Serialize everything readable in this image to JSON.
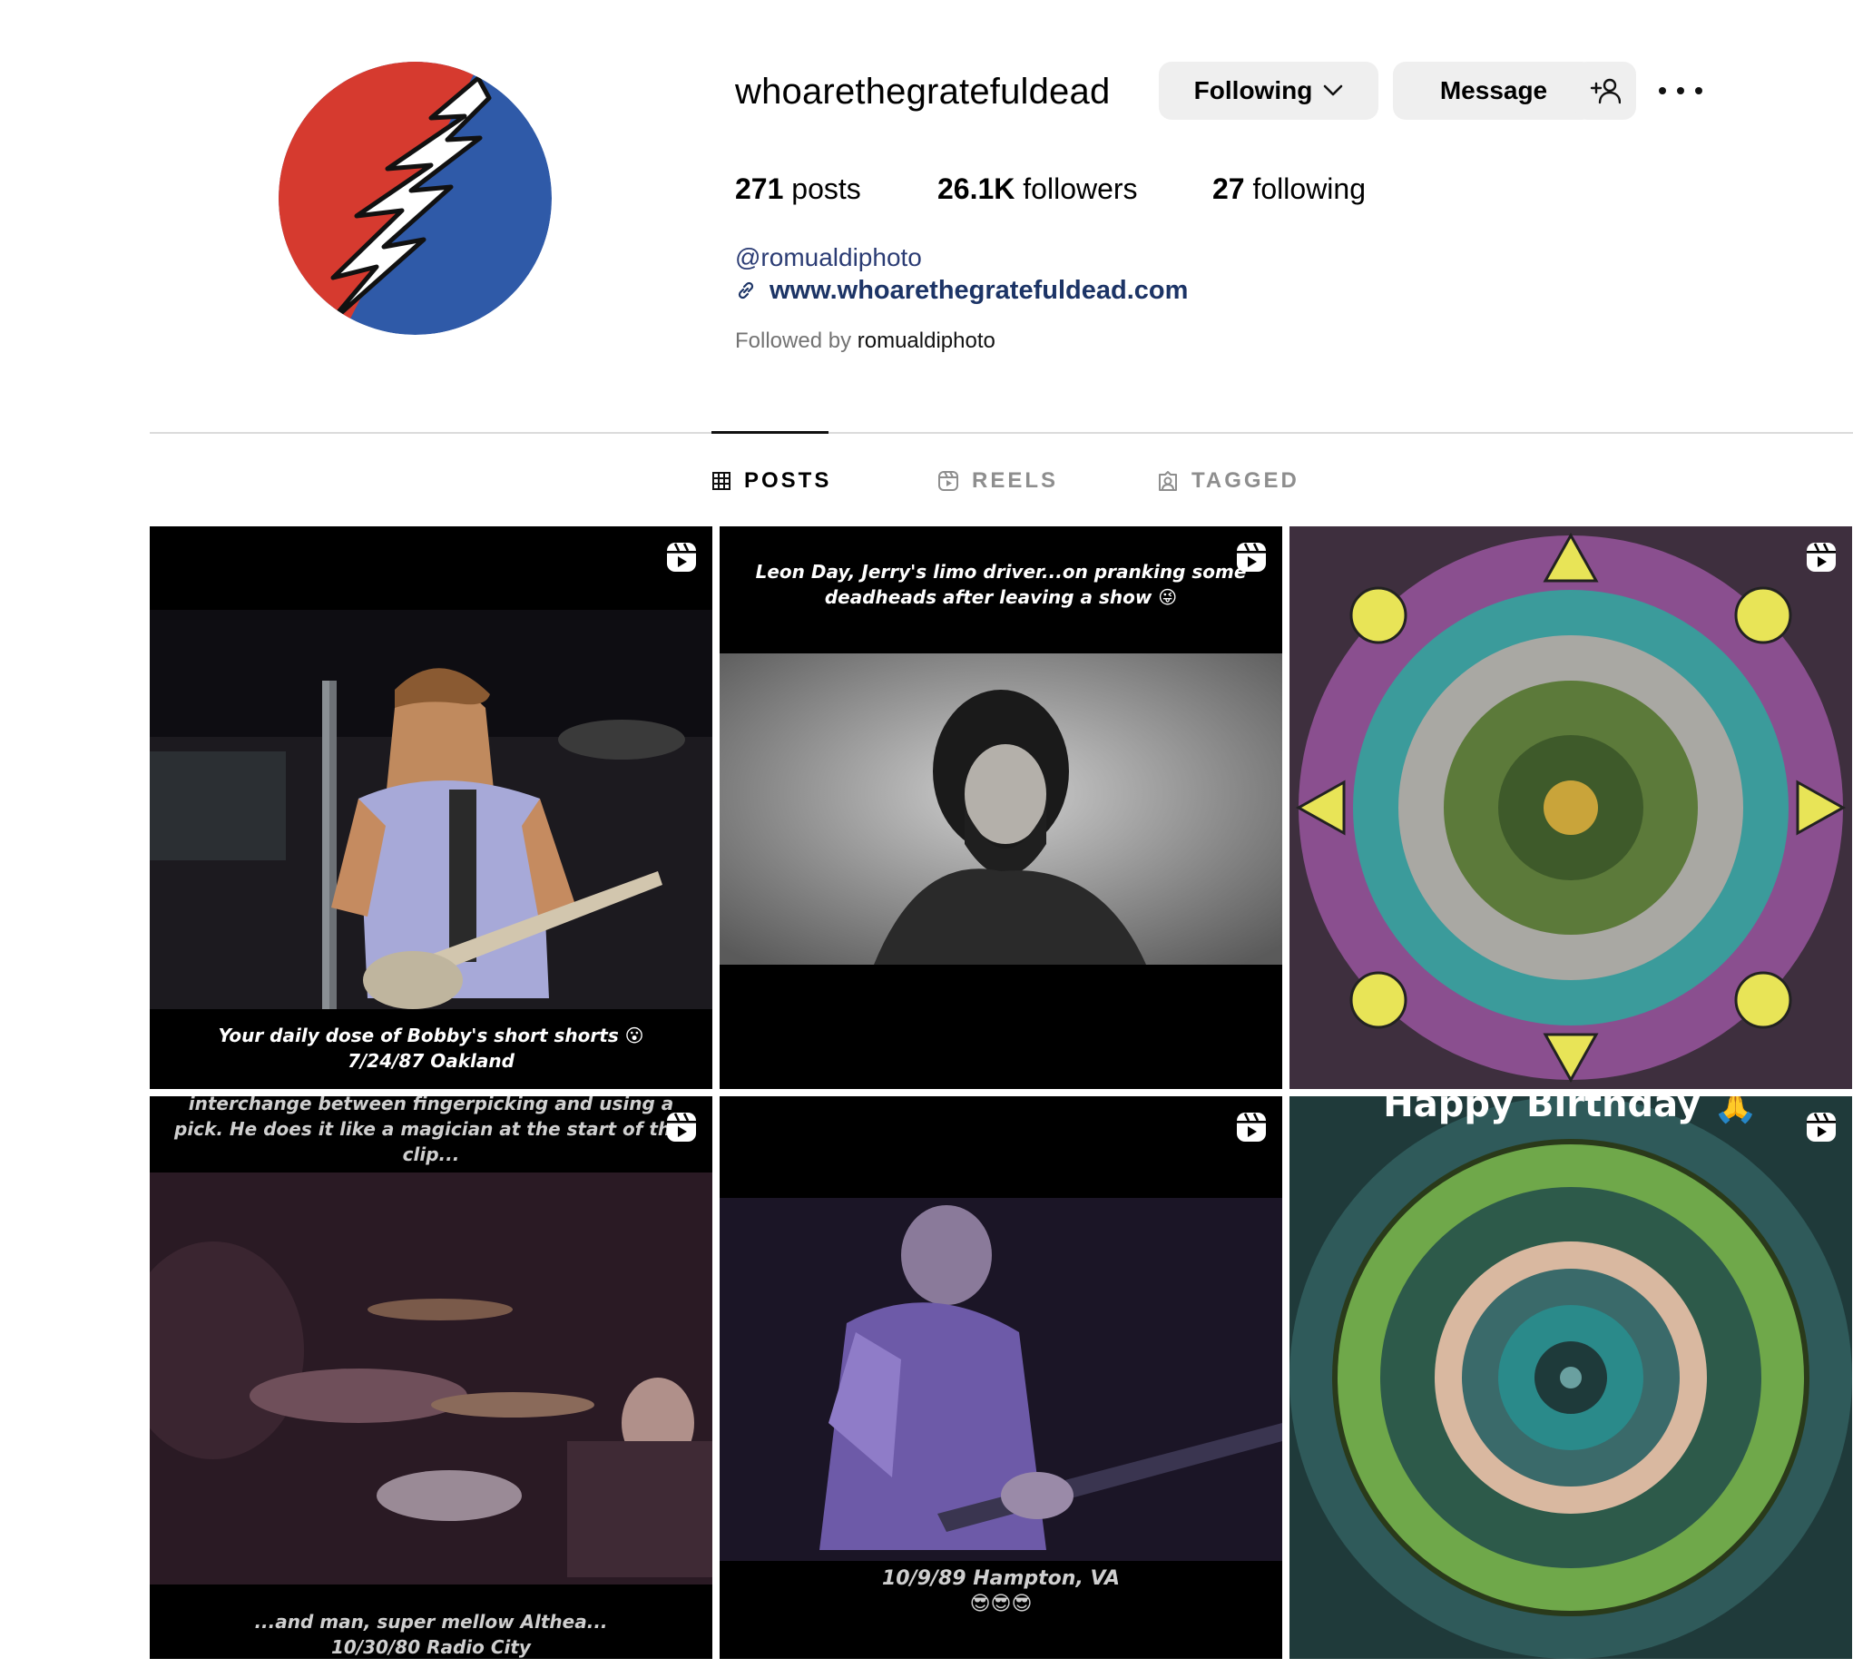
{
  "profile": {
    "username": "whoarethegratefuldead",
    "avatar_icon": "steal-your-face-lightning-bolt",
    "buttons": {
      "following": "Following",
      "message": "Message"
    },
    "stats": {
      "posts_count": "271",
      "posts_label": "posts",
      "followers_count": "26.1K",
      "followers_label": "followers",
      "following_count": "27",
      "following_label": "following"
    },
    "bio": {
      "handle": "@romualdiphoto",
      "website": "www.whoarethegratefuldead.com"
    },
    "followed_by": {
      "prefix": "Followed by",
      "user": "romualdiphoto"
    }
  },
  "tabs": [
    {
      "label": "POSTS",
      "icon": "grid-icon",
      "active": true
    },
    {
      "label": "REELS",
      "icon": "reels-icon",
      "active": false
    },
    {
      "label": "TAGGED",
      "icon": "tagged-icon",
      "active": false
    }
  ],
  "posts": [
    {
      "type": "reel",
      "caption_lines": [
        "Your daily dose of Bobby's short shorts 😮",
        "7/24/87 Oakland"
      ]
    },
    {
      "type": "reel",
      "caption_lines": [
        "Leon Day, Jerry's limo driver...on pranking some",
        "deadheads after leaving a show 😜"
      ]
    },
    {
      "type": "reel",
      "caption_lines": []
    },
    {
      "type": "reel",
      "caption_lines": [
        "interchange between fingerpicking and using a",
        "pick. He does it like a magician at the start of this",
        "clip...",
        "...and man,  super mellow Althea...",
        "10/30/80 Radio City"
      ]
    },
    {
      "type": "reel",
      "caption_lines": [
        "10/9/89 Hampton, VA",
        "😎😎😎"
      ]
    },
    {
      "type": "reel",
      "caption_lines": [
        "Happy Birthday 🙏"
      ]
    }
  ],
  "colors": {
    "button_bg": "#efefef",
    "link": "#1c3466",
    "muted": "#737373",
    "avatar_red": "#d63a2f",
    "avatar_blue": "#2f5aa8"
  }
}
